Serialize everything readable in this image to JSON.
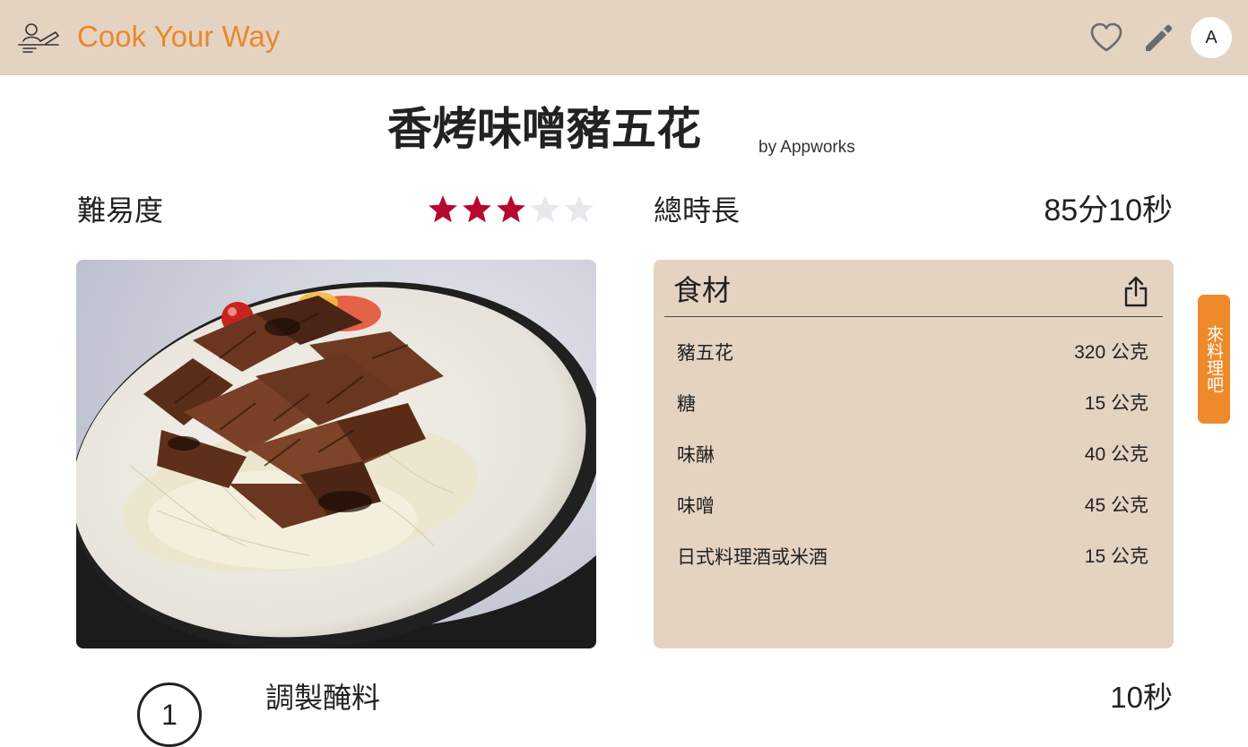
{
  "header": {
    "app_name": "Cook Your Way",
    "brand_color": "#e8892b",
    "bar_color": "#e5d3c2",
    "logo_icon": "chef-cooking-icon",
    "favorite_icon": "heart-icon",
    "edit_icon": "pencil-icon",
    "avatar_initial": "A"
  },
  "recipe": {
    "title": "香烤味噌豬五花",
    "author": "by Appworks",
    "difficulty_label": "難易度",
    "difficulty_rating": 3,
    "difficulty_max": 5,
    "star_color": "#b5092f",
    "time_label": "總時長",
    "total_time": "85分10秒"
  },
  "ingredients": {
    "title": "食材",
    "share_icon": "share-icon",
    "items": [
      {
        "name": "豬五花",
        "amount": "320 公克"
      },
      {
        "name": "糖",
        "amount": "15 公克"
      },
      {
        "name": "味醂",
        "amount": "40 公克"
      },
      {
        "name": "味噌",
        "amount": "45 公克"
      },
      {
        "name": "日式料理酒或米酒",
        "amount": "15 公克"
      }
    ]
  },
  "side_tab": {
    "label": "來料理吧",
    "color": "#ee8a2b"
  },
  "steps": [
    {
      "number": "1",
      "title": "調製醃料",
      "time": "10秒"
    }
  ]
}
